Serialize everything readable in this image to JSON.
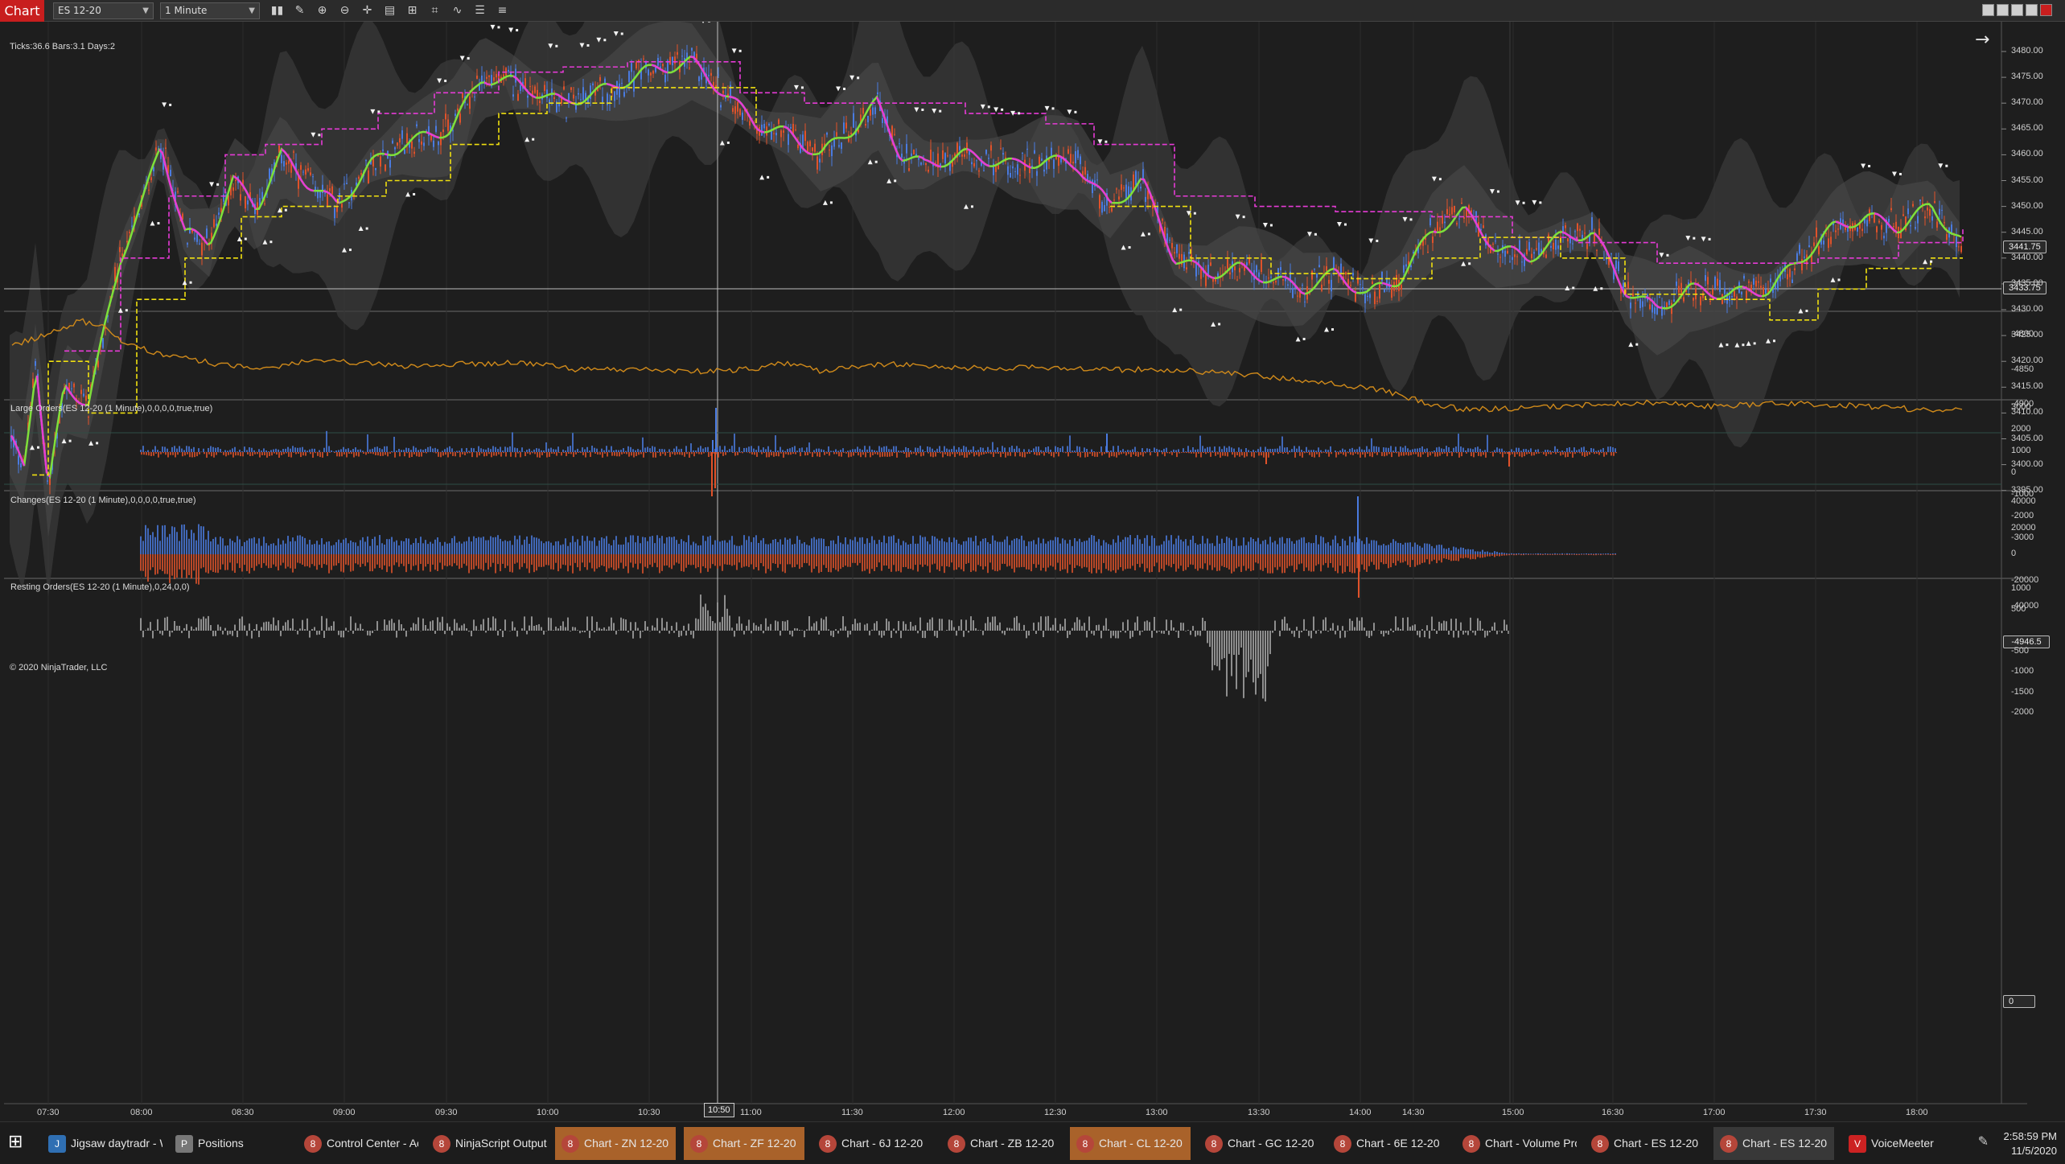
{
  "toolbar": {
    "chart_tab": "Chart",
    "instrument": "ES 12-20",
    "interval": "1 Minute",
    "buttons": [
      "bar-type-icon",
      "drawing-tool-icon",
      "zoom-in-icon",
      "zoom-out-icon",
      "crosshair-icon",
      "properties-icon",
      "templates-icon",
      "snapshot-icon",
      "indicators-icon",
      "strategies-icon",
      "data-box-icon"
    ]
  },
  "chart": {
    "info": "Ticks:36.6  Bars:3.1  Days:2",
    "copyright": "© 2020 NinjaTrader, LLC",
    "crosshair_time": "10:50",
    "last_price": "3441.75",
    "crosshair_price": "3433.75",
    "delta_value": "-4946.5",
    "resting_value": "0",
    "panels": [
      {
        "id": "price",
        "title": "",
        "labels": [
          "3480.00",
          "3475.00",
          "3470.00",
          "3465.00",
          "3460.00",
          "3455.00",
          "3450.00",
          "3445.00",
          "3440.00",
          "3435.00",
          "3430.00",
          "3425.00",
          "3420.00",
          "3415.00",
          "3410.00",
          "3405.00",
          "3400.00",
          "3395.00"
        ]
      },
      {
        "id": "delta",
        "title": "",
        "labels": [
          "-4800",
          "-4850",
          "-4900"
        ]
      },
      {
        "id": "large",
        "title": "Large Orders(ES 12-20 (1 Minute),0,0,0,0,true,true)",
        "labels": [
          "3000",
          "2000",
          "1000",
          "0",
          "-1000",
          "-2000",
          "-3000"
        ]
      },
      {
        "id": "changes",
        "title": "Changes(ES 12-20 (1 Minute),0,0,0,0,true,true)",
        "labels": [
          "40000",
          "20000",
          "0",
          "-20000",
          "-40000"
        ]
      },
      {
        "id": "resting",
        "title": "Resting Orders(ES 12-20 (1 Minute),0,24,0,0)",
        "labels": [
          "1000",
          "500",
          "-500",
          "-1000",
          "-1500",
          "-2000"
        ]
      }
    ],
    "time_labels": [
      "07:30",
      "08:00",
      "08:30",
      "09:00",
      "09:30",
      "10:00",
      "10:30",
      "11:00",
      "11:30",
      "12:00",
      "12:30",
      "13:00",
      "13:30",
      "14:00",
      "14:30",
      "15:00",
      "16:30",
      "17:00",
      "17:30",
      "18:00"
    ],
    "colors": {
      "up": "#4a7be0",
      "down": "#e0522a",
      "fast_ma": "#7ee03a",
      "slow_ma_down": "#e63bd6",
      "stop_line": "#f0e010",
      "delta_line": "#d08a1a",
      "grid": "#2c2c2c",
      "crosshair": "#bfbfbf"
    }
  },
  "taskbar": {
    "items": [
      {
        "label": "Jigsaw daytradr - W...",
        "icon": "jigsaw-icon",
        "style": "normal"
      },
      {
        "label": "Positions",
        "icon": "positions-icon",
        "style": "normal"
      },
      {
        "label": "Control Center - Ac...",
        "icon": "ninjatrader-icon",
        "style": "normal"
      },
      {
        "label": "NinjaScript Output",
        "icon": "ninjatrader-icon",
        "style": "normal"
      },
      {
        "label": "Chart - ZN 12-20",
        "icon": "ninjatrader-icon",
        "style": "orange"
      },
      {
        "label": "Chart - ZF 12-20",
        "icon": "ninjatrader-icon",
        "style": "orange"
      },
      {
        "label": "Chart - 6J 12-20",
        "icon": "ninjatrader-icon",
        "style": "normal"
      },
      {
        "label": "Chart - ZB 12-20",
        "icon": "ninjatrader-icon",
        "style": "normal"
      },
      {
        "label": "Chart - CL 12-20",
        "icon": "ninjatrader-icon",
        "style": "orange"
      },
      {
        "label": "Chart - GC 12-20",
        "icon": "ninjatrader-icon",
        "style": "normal"
      },
      {
        "label": "Chart - 6E 12-20",
        "icon": "ninjatrader-icon",
        "style": "normal"
      },
      {
        "label": "Chart - Volume Pro...",
        "icon": "ninjatrader-icon",
        "style": "normal"
      },
      {
        "label": "Chart - ES 12-20",
        "icon": "ninjatrader-icon",
        "style": "normal"
      },
      {
        "label": "Chart - ES 12-20",
        "icon": "ninjatrader-icon",
        "style": "active"
      },
      {
        "label": "VoiceMeeter",
        "icon": "voicemeeter-icon",
        "style": "normal"
      }
    ],
    "time": "2:58:59 PM",
    "date": "11/5/2020"
  }
}
